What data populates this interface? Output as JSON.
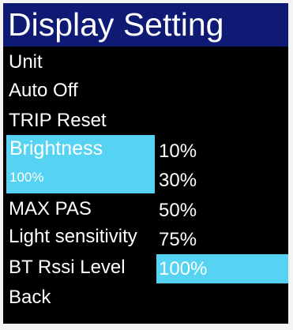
{
  "title": "Display Setting",
  "menu": {
    "unit": "Unit",
    "auto_off": "Auto Off",
    "trip_reset": "TRIP Reset",
    "brightness": "Brightness",
    "brightness_value": "100%",
    "max_pas": "MAX PAS",
    "light_sensitivity": "Light sensitivity",
    "bt_rssi_level": "BT Rssi Level",
    "back": "Back"
  },
  "options": [
    {
      "label": "10%",
      "selected": false
    },
    {
      "label": "30%",
      "selected": false
    },
    {
      "label": "50%",
      "selected": false
    },
    {
      "label": "75%",
      "selected": false
    },
    {
      "label": "100%",
      "selected": true
    }
  ],
  "colors": {
    "title_bar": "#0e1a73",
    "highlight": "#56d3f2",
    "screen_background": "#000000",
    "text": "#ffffff"
  }
}
